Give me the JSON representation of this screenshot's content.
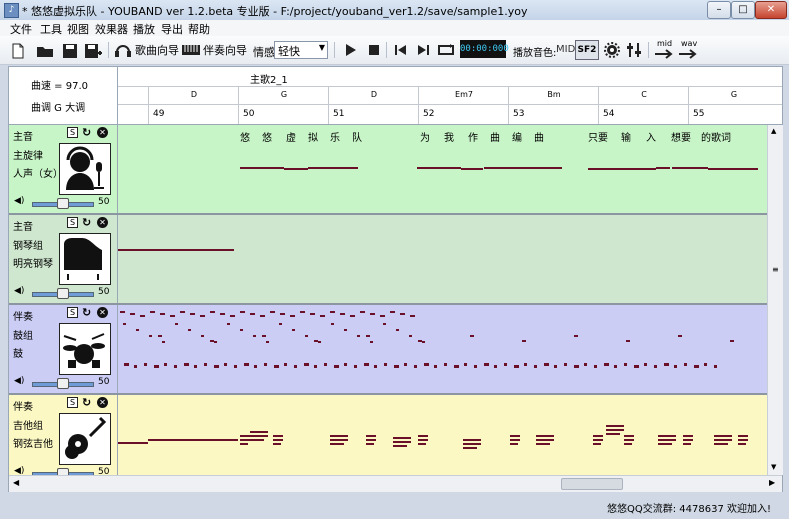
{
  "window": {
    "title": "* 悠悠虚拟乐队 - YOUBAND ver 1.2.beta 专业版  - F:/project/youband_ver1.2/save/sample1.yoy",
    "minimize": "–",
    "maximize": "□",
    "close": "✕"
  },
  "menu": [
    "文件",
    "工具",
    "视图",
    "效果器",
    "播放",
    "导出",
    "帮助"
  ],
  "toolbar": {
    "song_wizard": "歌曲向导",
    "accomp_wizard": "伴奏向导",
    "mood_label": "情感",
    "mood_value": "轻快",
    "time": "00:00:000",
    "play_tone_label": "播放音色:",
    "mid_label": "MID",
    "sf2_label": "SF2",
    "mid_export": "mid",
    "wav_export": "wav"
  },
  "header": {
    "tempo": "曲速 = 97.0",
    "key": "曲调  G 大调",
    "section": "主歌2_1",
    "chords": [
      "D",
      "G",
      "D",
      "Em7",
      "Bm",
      "C",
      "G"
    ],
    "bars": [
      "49",
      "50",
      "51",
      "52",
      "53",
      "54",
      "55"
    ]
  },
  "tracks": [
    {
      "type": "主音",
      "group": "主旋律",
      "instrument": "人声（女）",
      "volume": "50",
      "icon": "singer-icon",
      "color": "#c8f5c8",
      "lyrics": [
        "悠",
        "悠",
        "虚",
        "拟",
        "乐",
        "队",
        "为",
        "我",
        "作",
        "曲",
        "编",
        "曲",
        "只要",
        "输",
        "入",
        "想要",
        "的歌词"
      ]
    },
    {
      "type": "主音",
      "group": "钢琴组",
      "instrument": "明亮钢琴",
      "volume": "50",
      "icon": "piano-icon",
      "color": "#cfe6cf"
    },
    {
      "type": "伴奏",
      "group": "鼓组",
      "instrument": "鼓",
      "volume": "50",
      "icon": "drums-icon",
      "color": "#cccdf5"
    },
    {
      "type": "伴奏",
      "group": "吉他组",
      "instrument": "钢弦吉他",
      "volume": "50",
      "icon": "guitar-icon",
      "color": "#fbf8c4"
    }
  ],
  "track_buttons": {
    "solo": "S",
    "loop": "↻",
    "mute": "✕"
  },
  "status": "悠悠QQ交流群: 4478637  欢迎加入!",
  "colors": {
    "note": "#6a1028",
    "accent": "#6f9bd6"
  }
}
